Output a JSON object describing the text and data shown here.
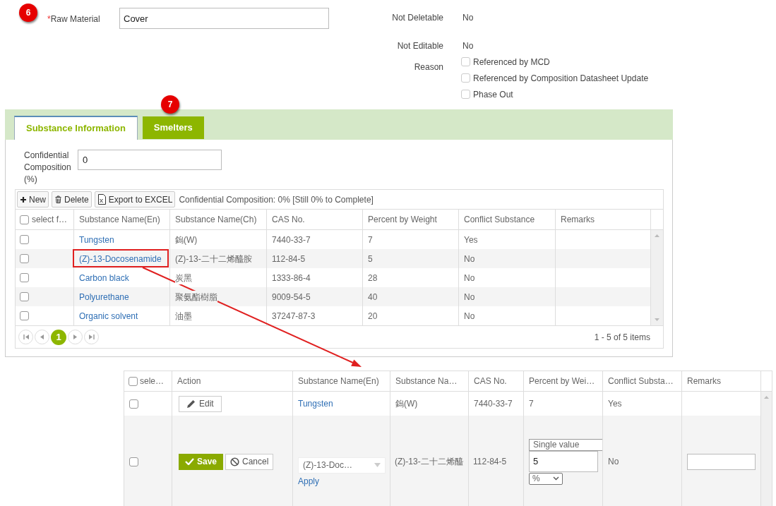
{
  "form": {
    "badge": "6",
    "raw_material": {
      "label": "Raw Material",
      "required_mark": "*",
      "value": "Cover"
    },
    "properties": [
      {
        "label": "Not Deletable",
        "value": "No"
      },
      {
        "label": "Not Editable",
        "value": "No"
      }
    ],
    "reason": {
      "label": "Reason",
      "options": [
        {
          "label": "Referenced by MCD",
          "checked": false
        },
        {
          "label": "Referenced by Composition Datasheet Update",
          "checked": false
        },
        {
          "label": "Phase Out",
          "checked": false
        }
      ]
    }
  },
  "tabs_badge": "7",
  "tabs": [
    {
      "label": "Substance Information",
      "selected": true
    },
    {
      "label": "Smelters",
      "selected": false
    }
  ],
  "confidential": {
    "label": "Confidential Composition (%)",
    "value": "0"
  },
  "toolbar": {
    "buttons": [
      {
        "label": "New",
        "kind": "new"
      },
      {
        "label": "Delete",
        "kind": "delete"
      },
      {
        "label": "Export to EXCEL",
        "kind": "excel"
      }
    ],
    "summary": "Confidential Composition: 0% [Still 0% to Complete]"
  },
  "table": {
    "select_all": {
      "label": "select f…",
      "checked": false
    },
    "columns": [
      "Substance Name(En)",
      "Substance Name(Ch)",
      "CAS No.",
      "Percent by Weight",
      "Conflict Substance",
      "Remarks"
    ],
    "rows": [
      {
        "checked": false,
        "callout": false,
        "name_en": "Tungsten",
        "name_ch": "鎢(W)",
        "cas": "7440-33-7",
        "percent": "7",
        "conflict": "Yes"
      },
      {
        "checked": false,
        "callout": true,
        "name_en": "(Z)-13-Docosenamide",
        "name_ch": "(Z)-13-二十二烯醯胺",
        "cas": "112-84-5",
        "percent": "5",
        "conflict": "No"
      },
      {
        "checked": false,
        "callout": false,
        "name_en": "Carbon black",
        "name_ch": "炭黑",
        "cas": "1333-86-4",
        "percent": "28",
        "conflict": "No"
      },
      {
        "checked": false,
        "callout": false,
        "name_en": "Polyurethane",
        "name_ch": "聚氨酯樹脂",
        "cas": "9009-54-5",
        "percent": "40",
        "conflict": "No"
      },
      {
        "checked": false,
        "callout": false,
        "name_en": "Organic solvent",
        "name_ch": "油墨",
        "cas": "37247-87-3",
        "percent": "20",
        "conflict": "No"
      }
    ],
    "pager": {
      "pages": [
        {
          "label": "1",
          "selected": true
        }
      ],
      "summary": "1 - 5 of 5 items"
    }
  },
  "edit_table": {
    "select_all": {
      "label": "sele…",
      "checked": false
    },
    "columns": [
      "Action",
      "Substance Name(En)",
      "Substance Na…",
      "CAS No.",
      "Percent by Wei…",
      "Conflict Substa…",
      "Remarks"
    ],
    "rows": [
      {
        "kind": "view",
        "checked": false,
        "action": "Edit",
        "name_en": "Tungsten",
        "name_ch": "鎢(W)",
        "cas": "7440-33-7",
        "percent": "7",
        "conflict": "Yes"
      },
      {
        "kind": "edit",
        "checked": false,
        "save": "Save",
        "cancel": "Cancel",
        "name_en": "(Z)-13-Doc…",
        "apply": "Apply",
        "name_ch": "(Z)-13-二十二烯醯",
        "cas": "112-84-5",
        "percent_mode": "Single value",
        "percent": "5",
        "unit": "%",
        "conflict": "No"
      }
    ]
  }
}
